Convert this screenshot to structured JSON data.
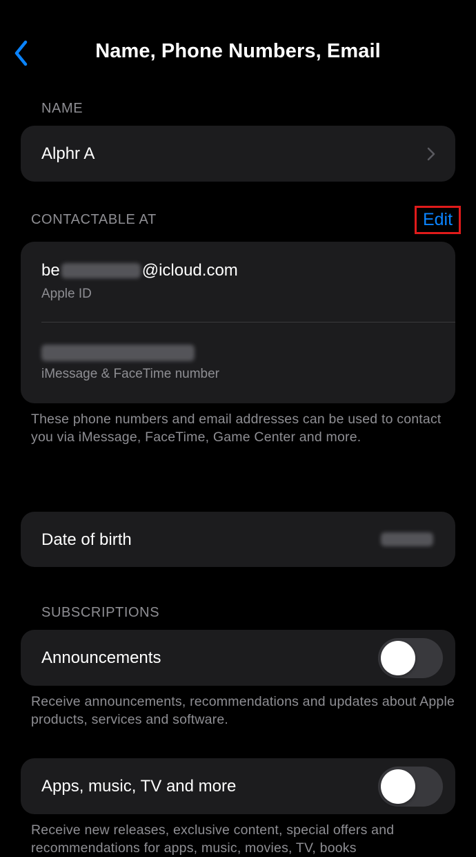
{
  "nav": {
    "title": "Name, Phone Numbers, Email"
  },
  "name_section": {
    "header": "NAME",
    "value": "Alphr A"
  },
  "contactable_section": {
    "header": "CONTACTABLE AT",
    "edit_label": "Edit",
    "email_prefix": "be",
    "email_suffix": "@icloud.com",
    "email_caption": "Apple ID",
    "phone_caption": "iMessage & FaceTime number",
    "footnote": "These phone numbers and email addresses can be used to contact you via iMessage, FaceTime, Game Center and more."
  },
  "dob": {
    "label": "Date of birth"
  },
  "subscriptions": {
    "header": "SUBSCRIPTIONS",
    "items": [
      {
        "label": "Announcements",
        "enabled": false,
        "footnote": "Receive announcements, recommendations and updates about Apple products, services and software."
      },
      {
        "label": "Apps, music, TV and more",
        "enabled": false,
        "footnote": "Receive new releases, exclusive content, special offers and recommendations for apps, music, movies, TV, books"
      }
    ]
  },
  "colors": {
    "background": "#000000",
    "card": "#1c1c1e",
    "accent": "#0a84ff",
    "secondary_text": "#8e8e93",
    "highlight_box": "#e01b1b",
    "toggle_off": "#39393d"
  }
}
